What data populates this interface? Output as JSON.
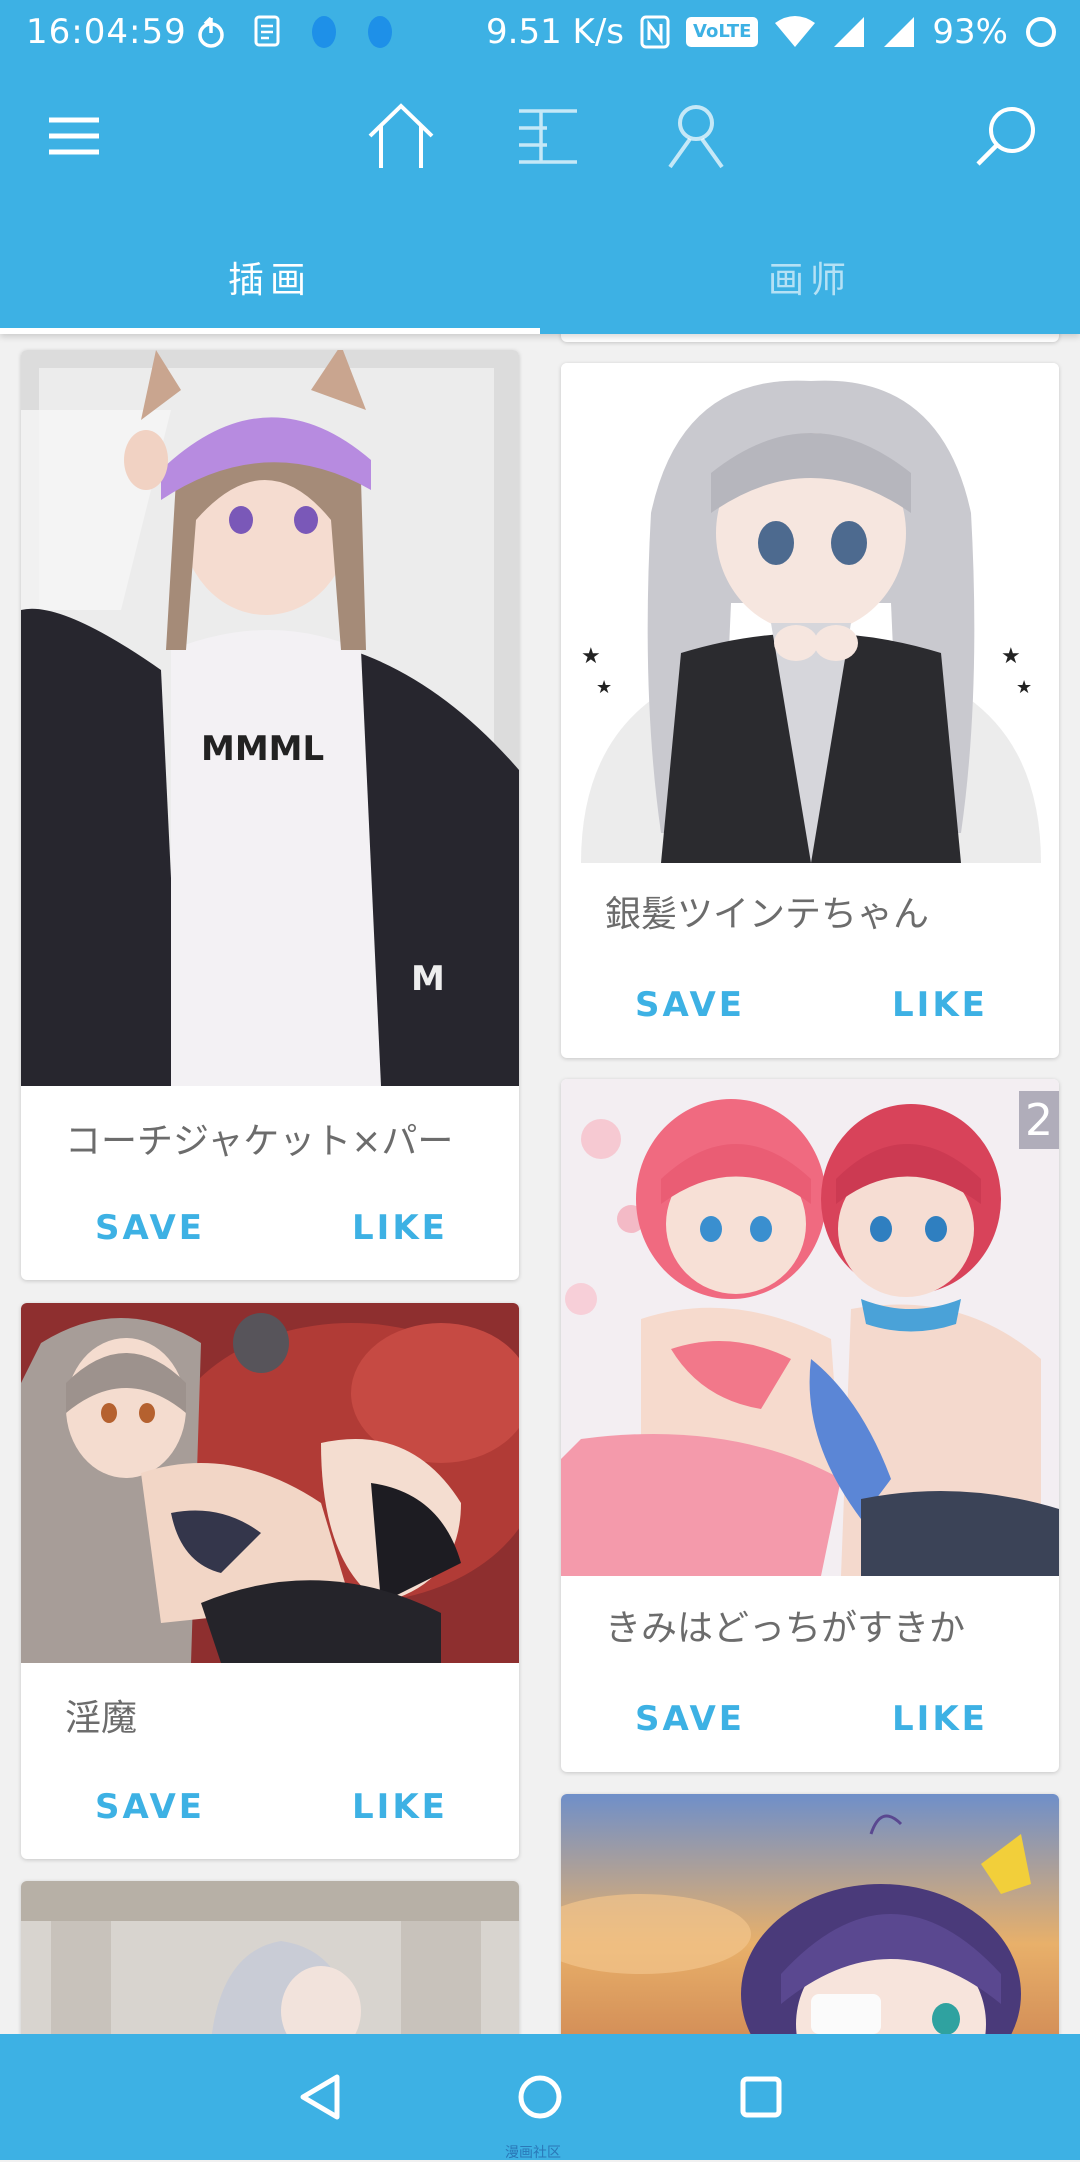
{
  "status_bar": {
    "time": "16:04:59",
    "net_speed": "9.51 K/s",
    "volte": "VoLTE",
    "battery": "93%",
    "icons": [
      "sync-icon",
      "document-icon",
      "notification-bubble-icon",
      "notification-bubble-icon",
      "nfc-icon",
      "wifi-icon",
      "signal-icon",
      "signal-icon",
      "battery-ring-icon"
    ]
  },
  "toolbar": {
    "icons": [
      "menu-icon",
      "home-icon",
      "rank-list-icon",
      "profile-icon",
      "search-icon"
    ]
  },
  "tabs": [
    {
      "label": "插画",
      "active": true
    },
    {
      "label": "画师",
      "active": false
    }
  ],
  "cards": [
    {
      "title": "コーチジャケット×パー",
      "save": "SAVE",
      "like": "LIKE"
    },
    {
      "title": "淫魔",
      "save": "SAVE",
      "like": "LIKE"
    },
    {
      "title": "銀髪ツインテちゃん",
      "save": "SAVE",
      "like": "LIKE"
    },
    {
      "title": "きみはどっちがすきか",
      "save": "SAVE",
      "like": "LIKE",
      "page_count": "2"
    }
  ],
  "navbar": {
    "icons": [
      "back-icon",
      "home-circle-icon",
      "recents-icon"
    ],
    "caption": "漫画社区"
  },
  "colors": {
    "accent": "#3db1e4",
    "card_text": "#6c6c6c",
    "background": "#f1f1f1"
  }
}
